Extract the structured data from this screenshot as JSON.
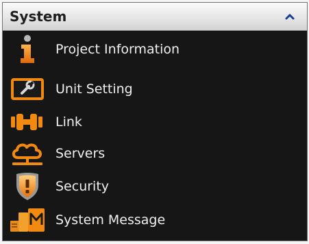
{
  "panel": {
    "title": "System",
    "collapse_icon": "chevron-up-icon",
    "accent_color": "#f28a12"
  },
  "items": [
    {
      "label": "Project Information",
      "icon": "info-icon"
    },
    {
      "label": "Unit Setting",
      "icon": "wrench-icon"
    },
    {
      "label": "Link",
      "icon": "link-icon"
    },
    {
      "label": "Servers",
      "icon": "cloud-server-icon"
    },
    {
      "label": "Security",
      "icon": "shield-icon"
    },
    {
      "label": "System Message",
      "icon": "message-icon"
    }
  ]
}
